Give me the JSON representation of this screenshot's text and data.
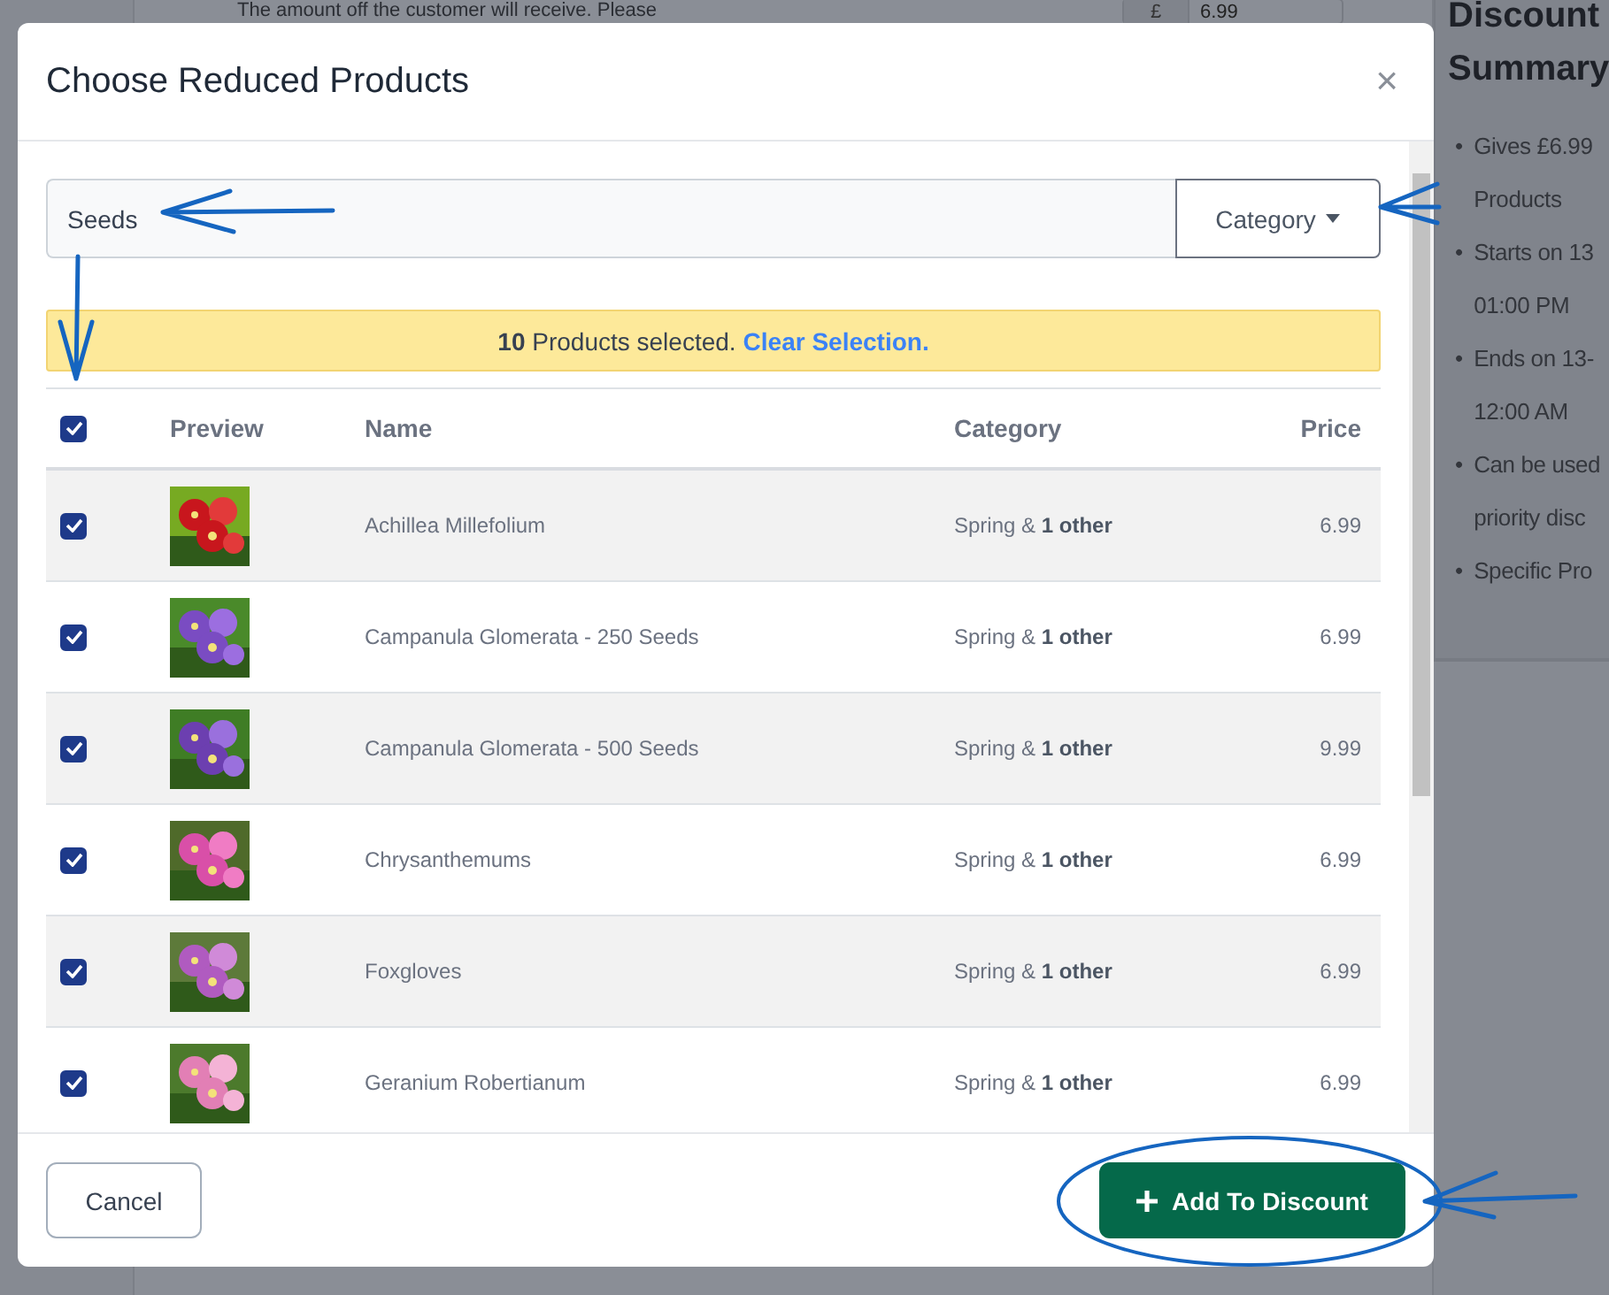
{
  "background": {
    "intro_text": "The amount off the customer will receive. Please",
    "currency": "£",
    "amount": "6.99",
    "summary": {
      "title": "Discount Summary",
      "bullet": "•",
      "items": [
        {
          "lines": [
            "Gives £6.99",
            "Products"
          ]
        },
        {
          "lines": [
            "Starts on 13",
            "01:00 PM"
          ]
        },
        {
          "lines": [
            "Ends on 13-",
            "12:00 AM"
          ]
        },
        {
          "lines": [
            "Can be used",
            "priority disc"
          ]
        },
        {
          "lines": [
            "Specific Pro"
          ]
        }
      ]
    }
  },
  "dialog": {
    "title": "Choose Reduced Products",
    "close": "×",
    "search": {
      "value": "Seeds"
    },
    "category_button": "Category",
    "selection_alert": {
      "count": "10",
      "text": "Products selected.",
      "link": "Clear Selection."
    },
    "table": {
      "all_checked": true,
      "columns": [
        "Preview",
        "Name",
        "Category",
        "Price"
      ],
      "rows": [
        {
          "checked": true,
          "name": "Achillea Millefolium",
          "category": "Spring & **1 other**",
          "price": "6.99"
        },
        {
          "checked": true,
          "name": "Campanula Glomerata - 250 Seeds",
          "category": "Spring & **1 other**",
          "price": "6.99"
        },
        {
          "checked": true,
          "name": "Campanula Glomerata - 500 Seeds",
          "category": "Spring & **1 other**",
          "price": "9.99"
        },
        {
          "checked": true,
          "name": "Chrysanthemums",
          "category": "Spring & **1 other**",
          "price": "6.99"
        },
        {
          "checked": true,
          "name": "Foxgloves",
          "category": "Spring & **1 other**",
          "price": "6.99"
        },
        {
          "checked": true,
          "name": "Geranium Robertianum",
          "category": "Spring & **1 other**",
          "price": "6.99"
        }
      ]
    },
    "buttons": {
      "cancel": "Cancel",
      "confirm": "Add To Discount"
    }
  }
}
